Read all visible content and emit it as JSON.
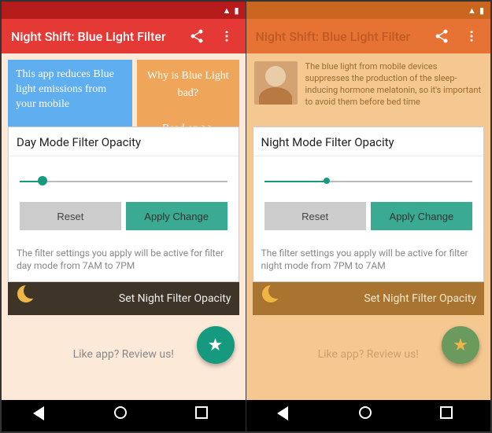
{
  "left": {
    "status": {
      "time": ""
    },
    "appbar": {
      "title": "Night Shift: Blue Light Filter"
    },
    "promo": {
      "blue": "This app reduces Blue light emissions from your mobile",
      "orange_title": "Why is Blue Light bad?",
      "orange_readon": "Read on >>"
    },
    "card": {
      "title": "Day Mode Filter Opacity",
      "reset": "Reset",
      "apply": "Apply Change",
      "footer": "The filter settings you apply will be active for filter day mode from 7AM to 7PM"
    },
    "night_bar": "Set Night Filter Opacity",
    "review": "Like app? Review us!"
  },
  "right": {
    "status": {
      "time": ""
    },
    "appbar": {
      "title": "Night Shift: Blue Light Filter"
    },
    "promo": {
      "info": "The blue light from mobile devices suppresses the production of the sleep-inducing hormone melatonin, so it's important to avoid them before bed time"
    },
    "card": {
      "title": "Night Mode Filter Opacity",
      "reset": "Reset",
      "apply": "Apply Change",
      "footer": "The filter settings you apply will be active for filter night mode from 7PM to 7AM"
    },
    "night_bar": "Set Night Filter Opacity",
    "review": "Like app? Review us!"
  }
}
